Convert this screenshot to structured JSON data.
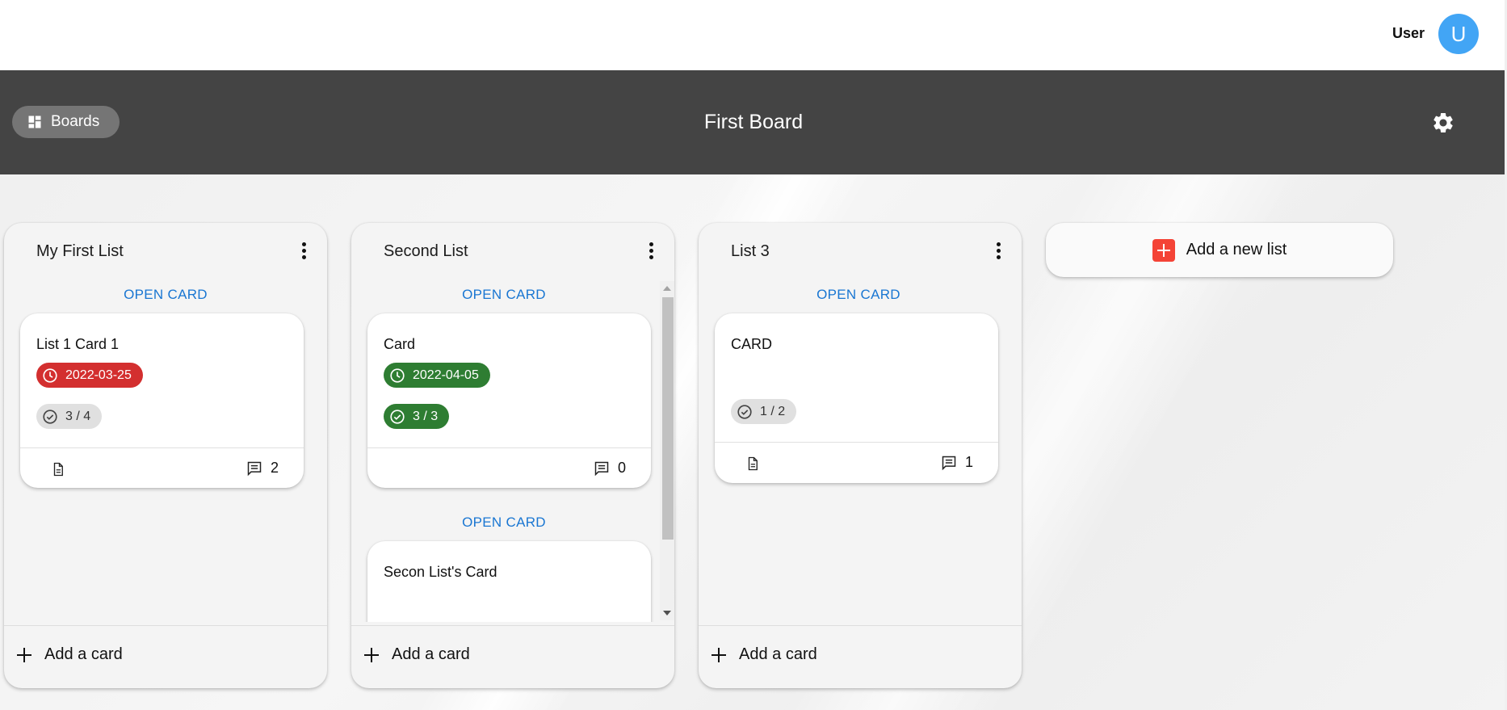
{
  "header": {
    "user_name": "User",
    "avatar_initial": "U"
  },
  "board_bar": {
    "boards_label": "Boards",
    "title": "First Board"
  },
  "lists": [
    {
      "title": "My First List",
      "open_card_label": "OPEN CARD",
      "cards": [
        {
          "title": "List 1 Card 1",
          "due_date": "2022-03-25",
          "due_status": "overdue",
          "checklist": "3 / 4",
          "has_description": true,
          "comment_count": "2"
        }
      ],
      "add_card_label": "Add a card"
    },
    {
      "title": "Second List",
      "open_card_label": "OPEN CARD",
      "cards": [
        {
          "title": "Card",
          "due_date": "2022-04-05",
          "due_status": "complete",
          "checklist": "3 / 3",
          "has_description": false,
          "comment_count": "0"
        },
        {
          "title": "Secon List's Card"
        }
      ],
      "add_card_label": "Add a card"
    },
    {
      "title": "List 3",
      "open_card_label": "OPEN CARD",
      "cards": [
        {
          "title": "CARD",
          "checklist": "1 / 2",
          "has_description": true,
          "comment_count": "1"
        }
      ],
      "add_card_label": "Add a card"
    }
  ],
  "new_list": {
    "label": "Add a new list"
  },
  "colors": {
    "board_bar": "#444444",
    "avatar": "#42a5f5",
    "link_blue": "#1976d2",
    "due_red": "#d32f2f",
    "done_green": "#2e7d32",
    "add_list_red": "#f44336"
  },
  "icons": [
    "dashboard-icon",
    "gear-icon",
    "more-vert-icon",
    "clock-icon",
    "check-circle-icon",
    "description-icon",
    "comment-icon",
    "plus-icon",
    "add-box-icon"
  ]
}
